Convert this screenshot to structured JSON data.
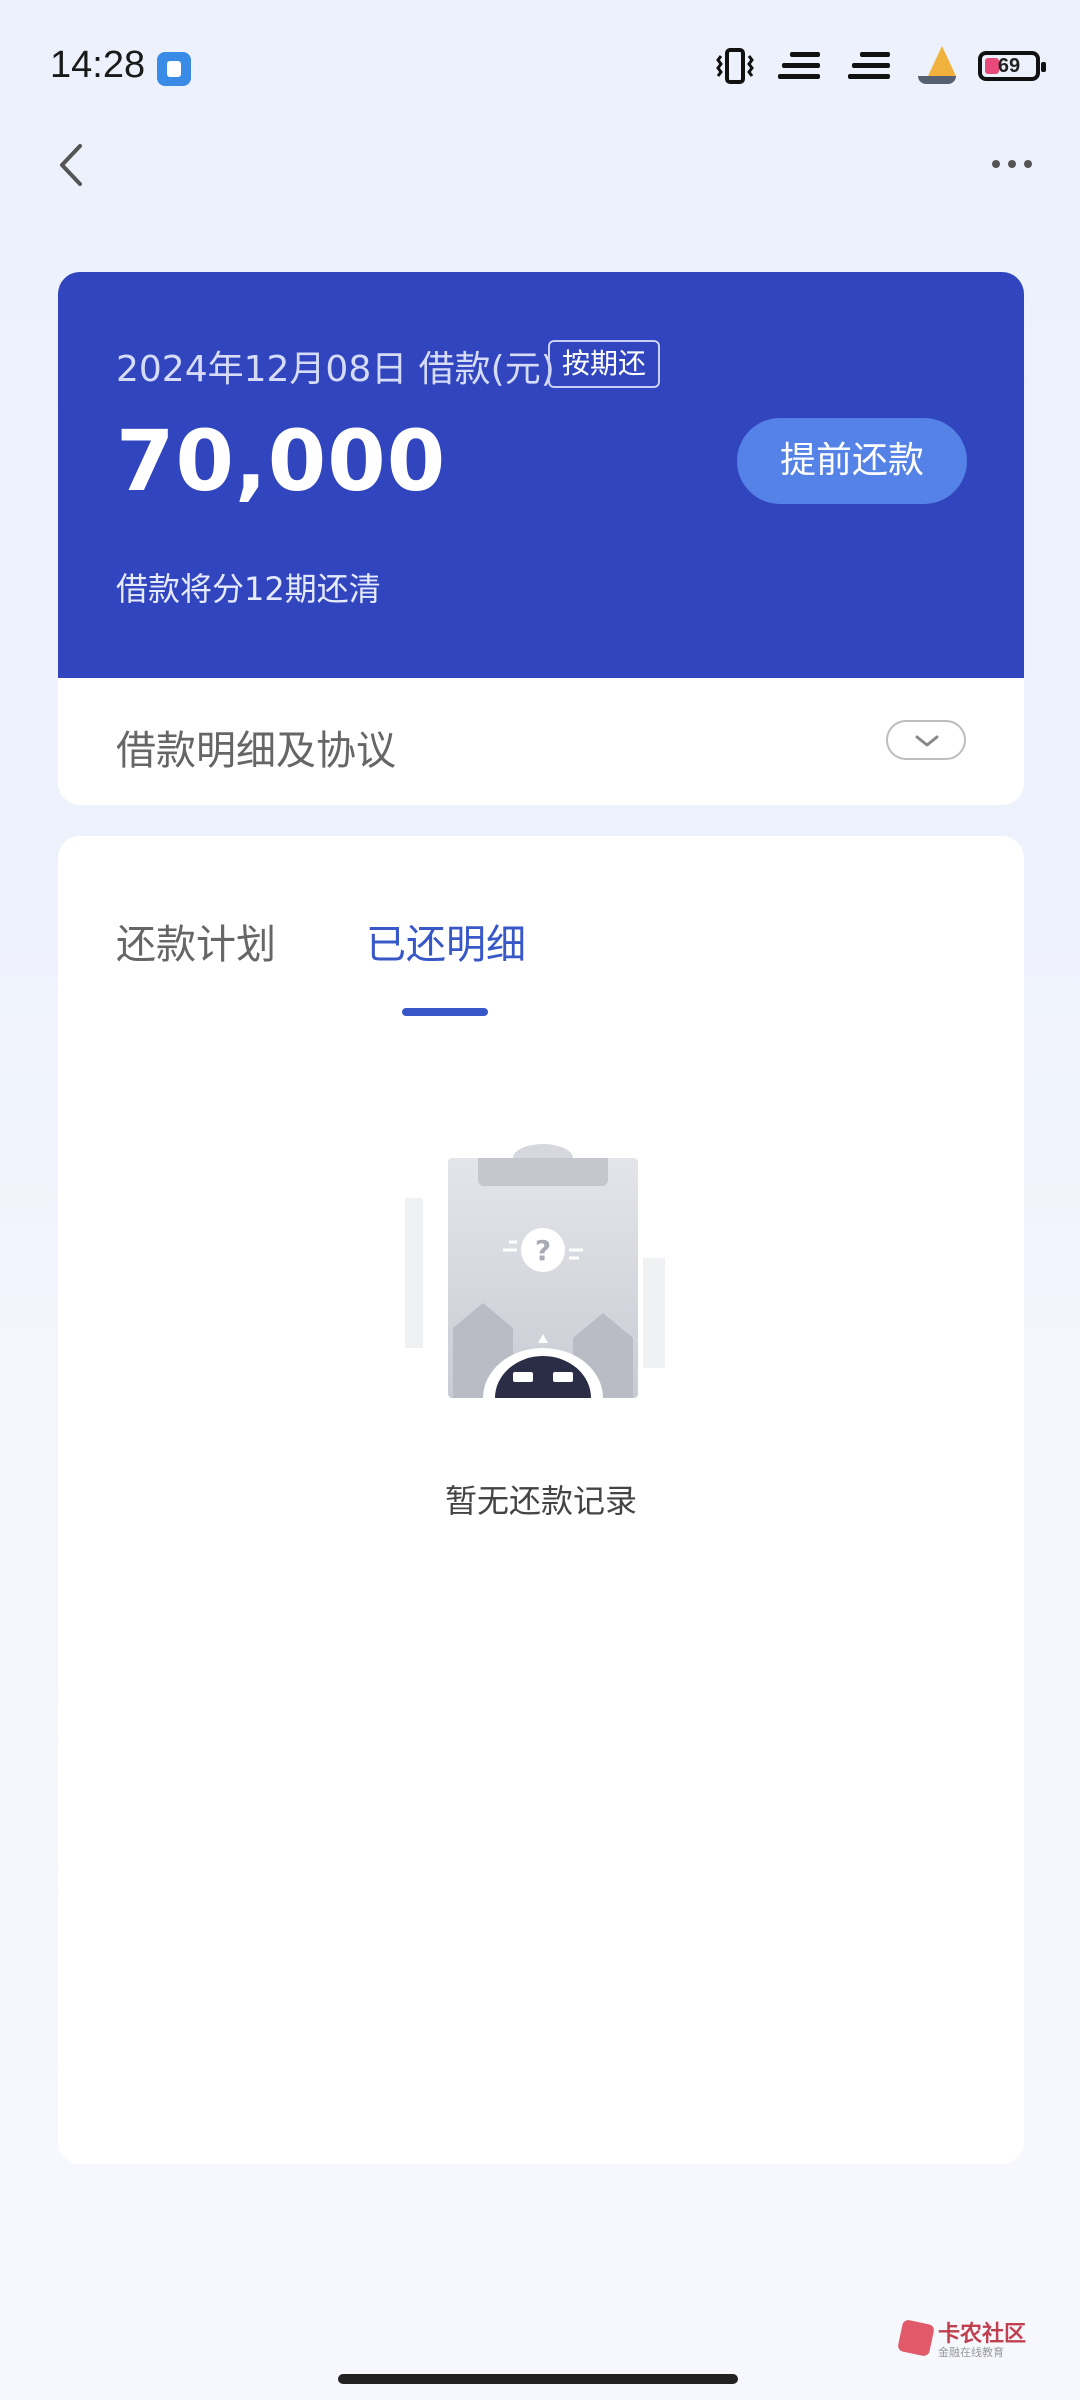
{
  "status_bar": {
    "time": "14:28",
    "battery_level": "69",
    "icons": [
      "app-badge-icon",
      "vibrate-icon",
      "signal-1-icon",
      "signal-2-icon",
      "sailboat-icon",
      "battery-icon"
    ]
  },
  "nav": {
    "back_icon": "chevron-left-icon",
    "more_icon": "more-horizontal-icon"
  },
  "loan": {
    "date_label": "2024年12月08日 借款(元)",
    "repay_type": "按期还",
    "amount": "70,000",
    "prepay_button": "提前还款",
    "term_text": "借款将分12期还清",
    "accent_color": "#3145be"
  },
  "detail": {
    "label": "借款明细及协议"
  },
  "tabs": {
    "items": [
      {
        "label": "还款计划",
        "active": false
      },
      {
        "label": "已还明细",
        "active": true
      }
    ],
    "active_color": "#3858c8"
  },
  "empty_state": {
    "message": "暂无还款记录"
  },
  "watermark": {
    "title": "卡农社区",
    "subtitle": "金融在线教育"
  }
}
